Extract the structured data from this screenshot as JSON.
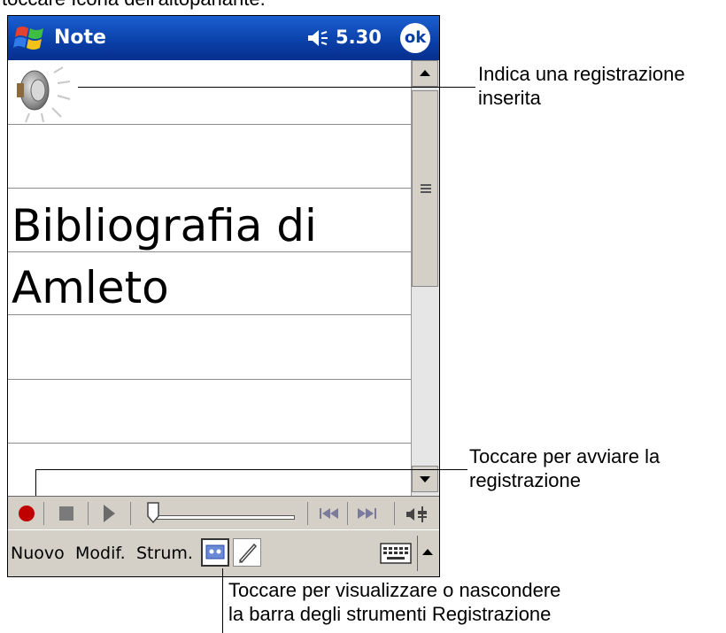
{
  "caption_top": "toccare Icona dell'altoparlante.",
  "titlebar": {
    "app_title": "Note",
    "time": "5.30",
    "ok_label": "ok",
    "start_icon": "windows-flag-icon",
    "volume_icon": "speaker-status-icon"
  },
  "note": {
    "line1": "Bibliografia di",
    "line2": "Amleto",
    "recording_icon": "speaker-recording-icon"
  },
  "menubar": {
    "new": "Nuovo",
    "edit": "Modif.",
    "tools": "Strum."
  },
  "callouts": {
    "recording_line1": "Indica una registrazione",
    "recording_line2": "inserita",
    "record_line1": "Toccare per avviare la",
    "record_line2": "registrazione",
    "toolbar_line1": "Toccare per visualizzare o nascondere",
    "toolbar_line2": "la barra degli strumenti Registrazione"
  },
  "colors": {
    "titlebar": "#0a3fa8",
    "record": "#c00000",
    "toolbar": "#d4d0c8"
  }
}
